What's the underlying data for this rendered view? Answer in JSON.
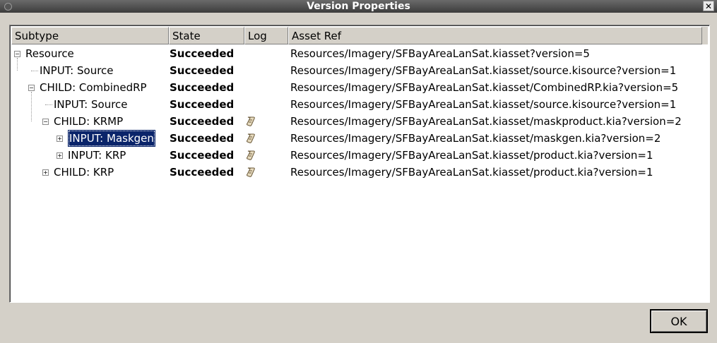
{
  "window": {
    "title": "Version Properties",
    "close_glyph": "✕"
  },
  "columns": [
    "Subtype",
    "State",
    "Log",
    "Asset Ref"
  ],
  "rows": [
    {
      "subtype": "Resource",
      "state": "Succeeded",
      "log": false,
      "asset_ref": "Resources/Imagery/SFBayAreaLanSat.kiasset?version=5",
      "depth": 0,
      "expander": "minus",
      "selected": false
    },
    {
      "subtype": "INPUT: Source",
      "state": "Succeeded",
      "log": false,
      "asset_ref": "Resources/Imagery/SFBayAreaLanSat.kiasset/source.kisource?version=1",
      "depth": 1,
      "expander": "none",
      "selected": false
    },
    {
      "subtype": "CHILD: CombinedRP",
      "state": "Succeeded",
      "log": false,
      "asset_ref": "Resources/Imagery/SFBayAreaLanSat.kiasset/CombinedRP.kia?version=5",
      "depth": 1,
      "expander": "minus",
      "selected": false
    },
    {
      "subtype": "INPUT: Source",
      "state": "Succeeded",
      "log": false,
      "asset_ref": "Resources/Imagery/SFBayAreaLanSat.kiasset/source.kisource?version=1",
      "depth": 2,
      "expander": "none",
      "selected": false
    },
    {
      "subtype": "CHILD: KRMP",
      "state": "Succeeded",
      "log": true,
      "asset_ref": "Resources/Imagery/SFBayAreaLanSat.kiasset/maskproduct.kia?version=2",
      "depth": 2,
      "expander": "minus",
      "selected": false
    },
    {
      "subtype": "INPUT: Maskgen",
      "state": "Succeeded",
      "log": true,
      "asset_ref": "Resources/Imagery/SFBayAreaLanSat.kiasset/maskgen.kia?version=2",
      "depth": 3,
      "expander": "plus",
      "selected": true
    },
    {
      "subtype": "INPUT: KRP",
      "state": "Succeeded",
      "log": true,
      "asset_ref": "Resources/Imagery/SFBayAreaLanSat.kiasset/product.kia?version=1",
      "depth": 3,
      "expander": "plus",
      "selected": false
    },
    {
      "subtype": "CHILD: KRP",
      "state": "Succeeded",
      "log": true,
      "asset_ref": "Resources/Imagery/SFBayAreaLanSat.kiasset/product.kia?version=1",
      "depth": 2,
      "expander": "plus",
      "selected": false
    }
  ],
  "footer": {
    "ok_label": "OK"
  },
  "icons": {
    "log": "scroll-icon"
  },
  "colors": {
    "selection": "#0a246a",
    "titlebar": "#4a4a4a"
  }
}
